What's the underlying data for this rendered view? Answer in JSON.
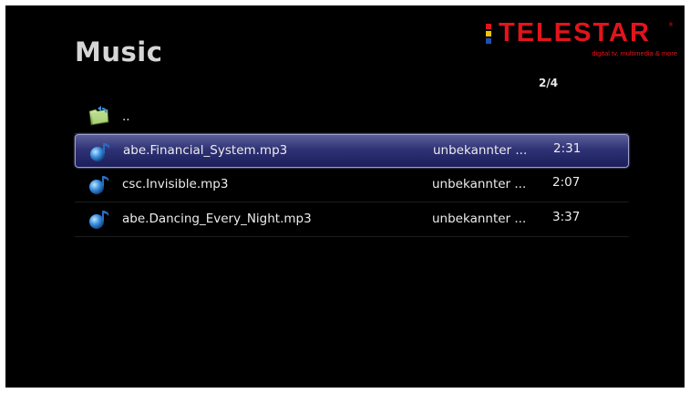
{
  "header": {
    "title": "Music",
    "page_indicator": "2/4"
  },
  "logo": {
    "text": "TELESTAR",
    "registered": "®",
    "tagline": "digital tv, multimedia & more",
    "colors": [
      "#e3141b",
      "#f2c400",
      "#1f4fb0"
    ]
  },
  "list": {
    "parent": {
      "label": "..",
      "icon": "folder-up-icon"
    },
    "items": [
      {
        "name": "abe.Financial_System.mp3",
        "artist": "unbekannter ...",
        "duration": "2:31",
        "selected": true,
        "icon": "music-note-icon"
      },
      {
        "name": "csc.Invisible.mp3",
        "artist": "unbekannter ...",
        "duration": "2:07",
        "selected": false,
        "icon": "music-note-icon"
      },
      {
        "name": "abe.Dancing_Every_Night.mp3",
        "artist": "unbekannter ...",
        "duration": "3:37",
        "selected": false,
        "icon": "music-note-icon"
      }
    ]
  },
  "colors": {
    "background": "#000000",
    "selection": "#2f3275",
    "text": "#ececec",
    "brand": "#e3141b"
  }
}
